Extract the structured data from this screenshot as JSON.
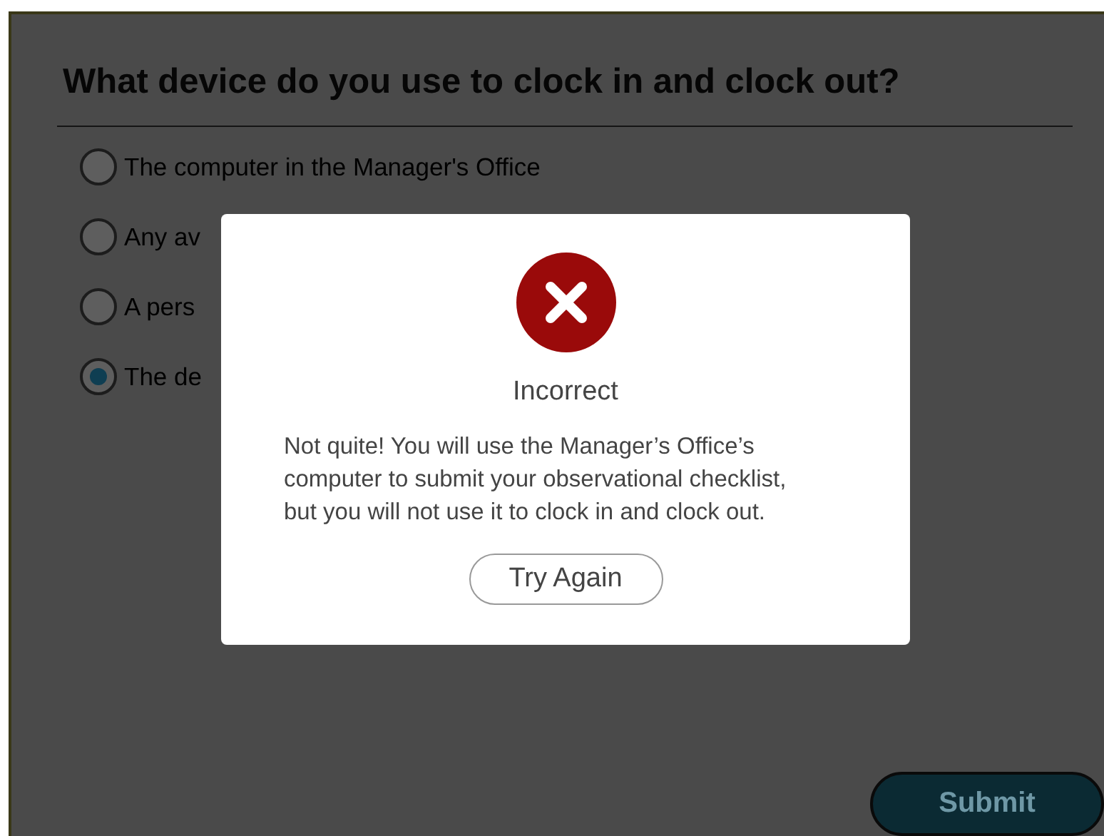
{
  "question": "What device do you use to clock in and clock out?",
  "options": [
    {
      "label": "The computer in the Manager's Office",
      "selected": false
    },
    {
      "label": "Any av",
      "selected": false
    },
    {
      "label": "A pers",
      "selected": false
    },
    {
      "label": "The de",
      "selected": true
    }
  ],
  "dialog": {
    "kind": "incorrect",
    "title": "Incorrect",
    "message": "Not quite!  You will use the Manager’s Office’s computer to submit your observational checklist, but you will not use it to clock in and clock out.",
    "button": "Try Again"
  },
  "submit": {
    "label": "Submit"
  }
}
